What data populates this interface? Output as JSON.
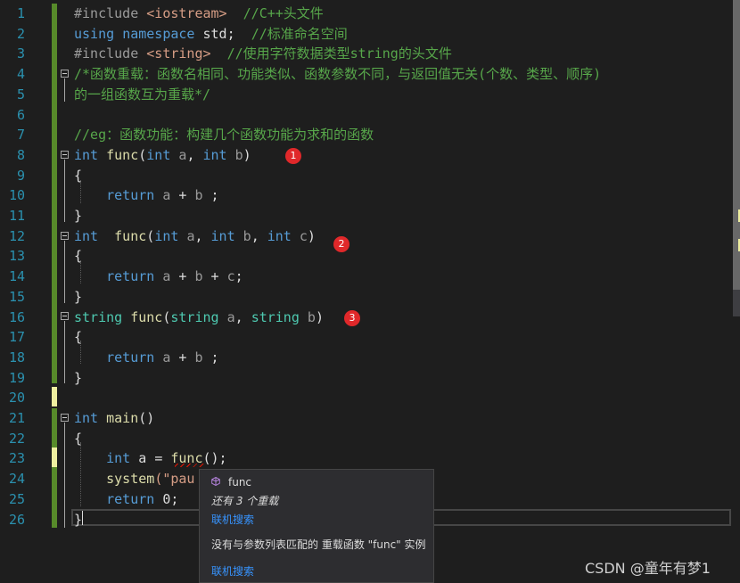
{
  "editor": {
    "line_numbers": [
      "1",
      "2",
      "3",
      "4",
      "5",
      "6",
      "7",
      "8",
      "9",
      "10",
      "11",
      "12",
      "13",
      "14",
      "15",
      "16",
      "17",
      "18",
      "19",
      "20",
      "21",
      "22",
      "23",
      "24",
      "25",
      "26"
    ],
    "lines": [
      [
        {
          "t": "#include ",
          "c": "pp"
        },
        {
          "t": "<iostream>",
          "c": "str"
        },
        {
          "t": "  //C++头文件",
          "c": "cm"
        }
      ],
      [
        {
          "t": "using ",
          "c": "kw"
        },
        {
          "t": "namespace ",
          "c": "kw"
        },
        {
          "t": "std",
          "c": "id"
        },
        {
          "t": ";  ",
          "c": "txt"
        },
        {
          "t": "//标准命名空间",
          "c": "cm"
        }
      ],
      [
        {
          "t": "#include ",
          "c": "pp"
        },
        {
          "t": "<string>",
          "c": "str"
        },
        {
          "t": "  //使用字符数据类型string的头文件",
          "c": "cm"
        }
      ],
      [
        {
          "t": "/*函数重载：函数名相同、功能类似、函数参数不同，与返回值无关(个数、类型、顺序)",
          "c": "cm"
        }
      ],
      [
        {
          "t": "的一组函数互为重载*/",
          "c": "cm"
        }
      ],
      [],
      [
        {
          "t": "//eg：函数功能：构建几个函数功能为求和的函数",
          "c": "cm"
        }
      ],
      [
        {
          "t": "int ",
          "c": "kw"
        },
        {
          "t": "func",
          "c": "fn"
        },
        {
          "t": "(",
          "c": "txt"
        },
        {
          "t": "int ",
          "c": "kw"
        },
        {
          "t": "a",
          "c": "par"
        },
        {
          "t": ", ",
          "c": "txt"
        },
        {
          "t": "int ",
          "c": "kw"
        },
        {
          "t": "b",
          "c": "par"
        },
        {
          "t": ")",
          "c": "txt"
        }
      ],
      [
        {
          "t": "{",
          "c": "txt"
        }
      ],
      [
        {
          "t": "    ",
          "c": "txt"
        },
        {
          "t": "return ",
          "c": "kw"
        },
        {
          "t": "a ",
          "c": "par"
        },
        {
          "t": "+ ",
          "c": "txt"
        },
        {
          "t": "b ",
          "c": "par"
        },
        {
          "t": ";",
          "c": "txt"
        }
      ],
      [
        {
          "t": "}",
          "c": "txt"
        }
      ],
      [
        {
          "t": "int ",
          "c": "kw"
        },
        {
          "t": " func",
          "c": "fn"
        },
        {
          "t": "(",
          "c": "txt"
        },
        {
          "t": "int ",
          "c": "kw"
        },
        {
          "t": "a",
          "c": "par"
        },
        {
          "t": ", ",
          "c": "txt"
        },
        {
          "t": "int ",
          "c": "kw"
        },
        {
          "t": "b",
          "c": "par"
        },
        {
          "t": ", ",
          "c": "txt"
        },
        {
          "t": "int ",
          "c": "kw"
        },
        {
          "t": "c",
          "c": "par"
        },
        {
          "t": ")",
          "c": "txt"
        }
      ],
      [
        {
          "t": "{",
          "c": "txt"
        }
      ],
      [
        {
          "t": "    ",
          "c": "txt"
        },
        {
          "t": "return ",
          "c": "kw"
        },
        {
          "t": "a ",
          "c": "par"
        },
        {
          "t": "+ ",
          "c": "txt"
        },
        {
          "t": "b ",
          "c": "par"
        },
        {
          "t": "+ ",
          "c": "txt"
        },
        {
          "t": "c",
          "c": "par"
        },
        {
          "t": ";",
          "c": "txt"
        }
      ],
      [
        {
          "t": "}",
          "c": "txt"
        }
      ],
      [
        {
          "t": "string ",
          "c": "ty"
        },
        {
          "t": "func",
          "c": "fn"
        },
        {
          "t": "(",
          "c": "txt"
        },
        {
          "t": "string ",
          "c": "ty"
        },
        {
          "t": "a",
          "c": "par"
        },
        {
          "t": ", ",
          "c": "txt"
        },
        {
          "t": "string ",
          "c": "ty"
        },
        {
          "t": "b",
          "c": "par"
        },
        {
          "t": ")",
          "c": "txt"
        }
      ],
      [
        {
          "t": "{",
          "c": "txt"
        }
      ],
      [
        {
          "t": "    ",
          "c": "txt"
        },
        {
          "t": "return ",
          "c": "kw"
        },
        {
          "t": "a ",
          "c": "par"
        },
        {
          "t": "+ ",
          "c": "txt"
        },
        {
          "t": "b ",
          "c": "par"
        },
        {
          "t": ";",
          "c": "txt"
        }
      ],
      [
        {
          "t": "}",
          "c": "txt"
        }
      ],
      [],
      [
        {
          "t": "int ",
          "c": "kw"
        },
        {
          "t": "main",
          "c": "fn"
        },
        {
          "t": "()",
          "c": "txt"
        }
      ],
      [
        {
          "t": "{",
          "c": "txt"
        }
      ],
      [
        {
          "t": "    ",
          "c": "txt"
        },
        {
          "t": "int ",
          "c": "kw"
        },
        {
          "t": "a ",
          "c": "id"
        },
        {
          "t": "= ",
          "c": "txt"
        },
        {
          "t": "func",
          "c": "fn"
        },
        {
          "t": "();",
          "c": "txt"
        }
      ],
      [
        {
          "t": "    ",
          "c": "txt"
        },
        {
          "t": "system",
          "c": "fn"
        },
        {
          "t": "(\"pau",
          "c": "str"
        }
      ],
      [
        {
          "t": "    ",
          "c": "txt"
        },
        {
          "t": "return ",
          "c": "kw"
        },
        {
          "t": "0;",
          "c": "txt"
        }
      ],
      [
        {
          "t": "}",
          "c": "txt"
        }
      ]
    ]
  },
  "badges": [
    "1",
    "2",
    "3"
  ],
  "popup": {
    "icon": "method-cube-icon",
    "name": "func",
    "overloads": "还有 3 个重载",
    "search_link_1": "联机搜索",
    "message": "没有与参数列表匹配的 重载函数 \"func\" 实例",
    "search_link_2": "联机搜索"
  },
  "watermark": "CSDN @童年有梦1",
  "colors": {
    "background": "#1e1e1e",
    "keyword": "#569cd6",
    "comment": "#57a64a",
    "string": "#d69d85",
    "function": "#dcdcaa",
    "type": "#4ec9b0",
    "line_number": "#2b91af",
    "badge": "#e0282a",
    "link": "#3794ff"
  }
}
